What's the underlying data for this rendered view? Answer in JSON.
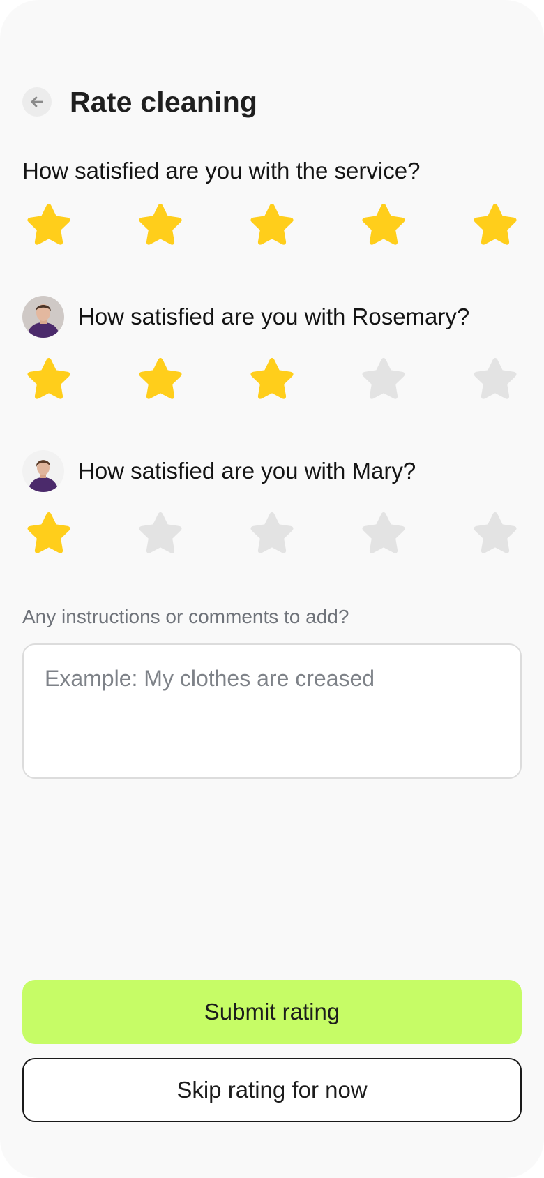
{
  "header": {
    "title": "Rate cleaning",
    "back_icon": "arrow-left-icon"
  },
  "service_rating": {
    "question": "How satisfied are you with the service?",
    "rating": 5,
    "max": 5
  },
  "cleaners": [
    {
      "question": "How satisfied are you with Rosemary?",
      "avatar": "person-avatar",
      "rating": 3,
      "max": 5
    },
    {
      "question": "How satisfied are you with Mary?",
      "avatar": "person-avatar",
      "rating": 1,
      "max": 5
    }
  ],
  "comments": {
    "label": "Any instructions or comments to add?",
    "placeholder": "Example: My clothes are creased",
    "value": ""
  },
  "actions": {
    "submit_label": "Submit rating",
    "skip_label": "Skip rating for now"
  },
  "colors": {
    "star_filled": "#FFCE1B",
    "star_empty": "#E3E3E3",
    "submit_bg": "#C6FC66",
    "background": "#F9F9F9"
  }
}
